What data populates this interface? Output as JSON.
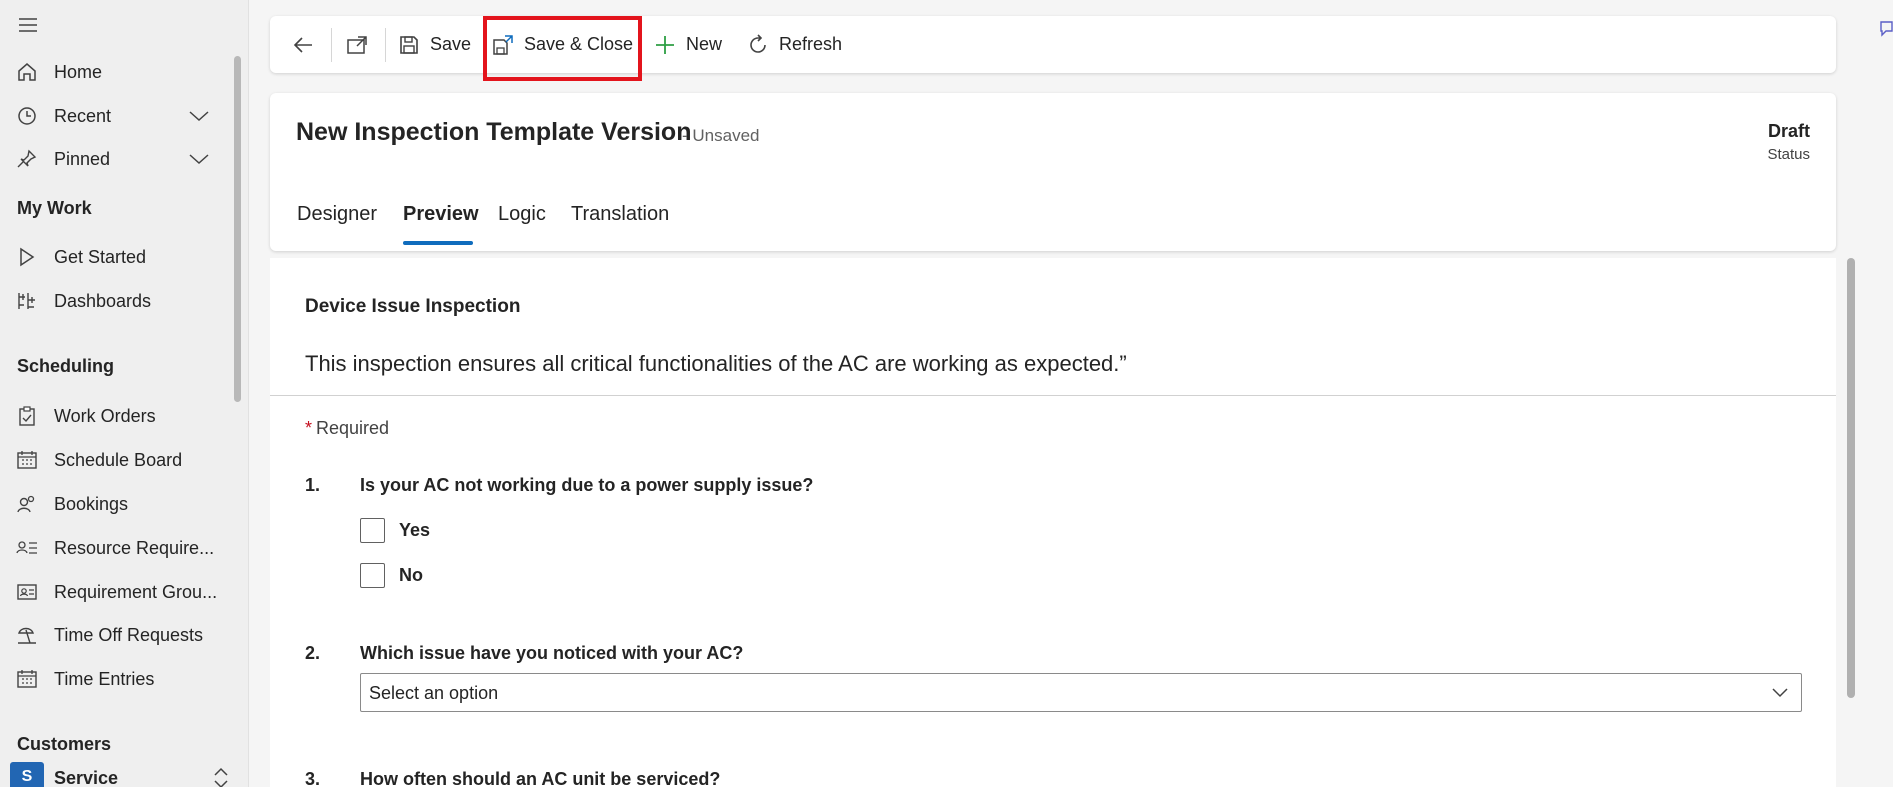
{
  "sidebar": {
    "items_top": [
      {
        "label": "Home",
        "icon": "home-icon"
      },
      {
        "label": "Recent",
        "icon": "clock-icon",
        "expandable": true
      },
      {
        "label": "Pinned",
        "icon": "pin-icon",
        "expandable": true
      }
    ],
    "my_work": {
      "title": "My Work",
      "items": [
        {
          "label": "Get Started",
          "icon": "play-icon"
        },
        {
          "label": "Dashboards",
          "icon": "dashboard-icon"
        }
      ]
    },
    "scheduling": {
      "title": "Scheduling",
      "items": [
        {
          "label": "Work Orders",
          "icon": "clipboard-icon"
        },
        {
          "label": "Schedule Board",
          "icon": "calendar-icon"
        },
        {
          "label": "Bookings",
          "icon": "people-icon"
        },
        {
          "label": "Resource Require...",
          "icon": "person-list-icon"
        },
        {
          "label": "Requirement Grou...",
          "icon": "contact-card-icon"
        },
        {
          "label": "Time Off Requests",
          "icon": "beach-icon"
        },
        {
          "label": "Time Entries",
          "icon": "calendar-icon"
        }
      ]
    },
    "customers": {
      "title": "Customers"
    },
    "area": {
      "badge": "S",
      "label": "Service"
    }
  },
  "toolbar": {
    "save_label": "Save",
    "save_close_label": "Save & Close",
    "new_label": "New",
    "refresh_label": "Refresh"
  },
  "record": {
    "title": "New Inspection Template Version",
    "subtitle": "- Unsaved",
    "status_value": "Draft",
    "status_label": "Status"
  },
  "tabs": [
    {
      "label": "Designer",
      "active": false
    },
    {
      "label": "Preview",
      "active": true
    },
    {
      "label": "Logic",
      "active": false
    },
    {
      "label": "Translation",
      "active": false
    }
  ],
  "form": {
    "title": "Device Issue Inspection",
    "description": "This inspection ensures all critical functionalities of the AC are working as expected.”",
    "required_label": "Required",
    "questions": [
      {
        "number": "1.",
        "text": "Is your AC not working due to a power supply issue?",
        "options": [
          "Yes",
          "No"
        ]
      },
      {
        "number": "2.",
        "text": "Which issue have you noticed with your AC?",
        "select_value": "Select an option"
      },
      {
        "number": "3.",
        "text": "How often should an AC unit be serviced?"
      }
    ]
  },
  "colors": {
    "accent": "#0f6cbd",
    "highlight": "#e3141c",
    "required_star": "#c50f1f",
    "new_plus": "#2e9e44"
  }
}
